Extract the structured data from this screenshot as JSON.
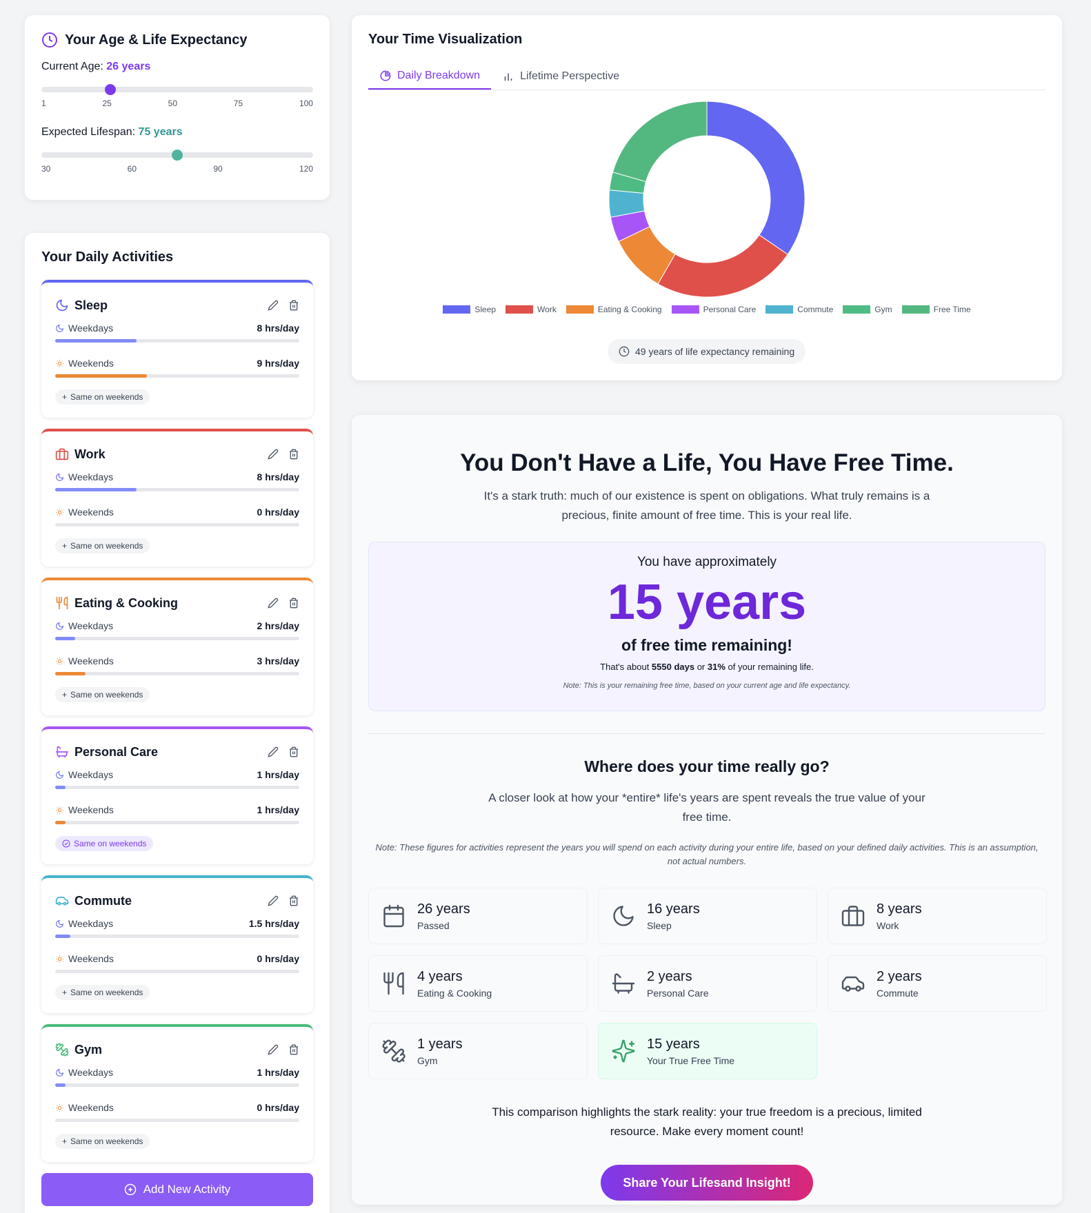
{
  "age": {
    "title": "Your Age & Life Expectancy",
    "current_label": "Current Age:",
    "current_value": "26 years",
    "current_fraction": 0.253,
    "age_ticks": [
      "1",
      "25",
      "50",
      "75",
      "100"
    ],
    "life_label": "Expected Lifespan:",
    "life_value": "75 years",
    "life_fraction": 0.5,
    "life_ticks": [
      "30",
      "60",
      "90",
      "120"
    ]
  },
  "activities": {
    "title": "Your Daily Activities",
    "weekdays_label": "Weekdays",
    "weekends_label": "Weekends",
    "same_label": "Same on weekends",
    "add_label": "Add New Activity",
    "items": [
      {
        "name": "Sleep",
        "icon": "moon-icon",
        "color": "#6366f1",
        "weekdays": "8 hrs/day",
        "weekends": "9 hrs/day",
        "wd_fraction": 0.333,
        "we_fraction": 0.375,
        "same": false
      },
      {
        "name": "Work",
        "icon": "briefcase-icon",
        "color": "#e0504a",
        "weekdays": "8 hrs/day",
        "weekends": "0 hrs/day",
        "wd_fraction": 0.333,
        "we_fraction": 0,
        "same": false
      },
      {
        "name": "Eating & Cooking",
        "icon": "utensils-icon",
        "color": "#ed8936",
        "weekdays": "2 hrs/day",
        "weekends": "3 hrs/day",
        "wd_fraction": 0.083,
        "we_fraction": 0.125,
        "same": false
      },
      {
        "name": "Personal Care",
        "icon": "bath-icon",
        "color": "#a855f7",
        "weekdays": "1 hrs/day",
        "weekends": "1 hrs/day",
        "wd_fraction": 0.042,
        "we_fraction": 0.042,
        "same": true
      },
      {
        "name": "Commute",
        "icon": "car-icon",
        "color": "#45b3d0",
        "weekdays": "1.5 hrs/day",
        "weekends": "0 hrs/day",
        "wd_fraction": 0.0625,
        "we_fraction": 0,
        "same": false
      },
      {
        "name": "Gym",
        "icon": "dumbbell-icon",
        "color": "#48bb78",
        "weekdays": "1 hrs/day",
        "weekends": "0 hrs/day",
        "wd_fraction": 0.042,
        "we_fraction": 0,
        "same": false
      }
    ]
  },
  "viz": {
    "title": "Your Time Visualization",
    "tabs": [
      {
        "label": "Daily Breakdown",
        "active": true
      },
      {
        "label": "Lifetime Perspective",
        "active": false
      }
    ],
    "remaining_label": "49 years of life expectancy remaining"
  },
  "chart_data": {
    "type": "pie",
    "donut": true,
    "categories": [
      "Sleep",
      "Work",
      "Eating & Cooking",
      "Personal Care",
      "Commute",
      "Gym",
      "Free Time"
    ],
    "values": [
      8.29,
      5.71,
      2.29,
      1.0,
      1.07,
      0.71,
      4.93
    ],
    "colors": [
      "#6366f1",
      "#e0504a",
      "#ed8936",
      "#a855f7",
      "#4fb3d0",
      "#4fbb84",
      "#53b880"
    ],
    "legend_position": "bottom"
  },
  "insight": {
    "title": "You Don't Have a Life, You Have Free Time.",
    "intro": "It's a stark truth: much of our existence is spent on obligations. What truly remains is a precious, finite amount of free time. This is your real life.",
    "approx": "You have approximately",
    "years": "15 years",
    "remaining": "of free time remaining!",
    "days_prefix": "That's about ",
    "days": "5550 days",
    "days_mid": " or ",
    "percent": "31%",
    "days_suffix": " of your remaining life.",
    "note": "Note: This is your remaining free time, based on your current age and life expectancy.",
    "where_title": "Where does your time really go?",
    "where_intro": "A closer look at how your *entire* life's years are spent reveals the true value of your free time.",
    "where_note": "Note: These figures for activities represent the years you will spend on each activity during your entire life, based on your defined daily activities. This is an assumption, not actual numbers.",
    "stats": [
      {
        "value": "26 years",
        "label": "Passed",
        "icon": "calendar-icon"
      },
      {
        "value": "16 years",
        "label": "Sleep",
        "icon": "moon-icon"
      },
      {
        "value": "8 years",
        "label": "Work",
        "icon": "briefcase-icon"
      },
      {
        "value": "4 years",
        "label": "Eating & Cooking",
        "icon": "utensils-icon"
      },
      {
        "value": "2 years",
        "label": "Personal Care",
        "icon": "bath-icon"
      },
      {
        "value": "2 years",
        "label": "Commute",
        "icon": "car-icon"
      },
      {
        "value": "1 years",
        "label": "Gym",
        "icon": "dumbbell-icon"
      },
      {
        "value": "15 years",
        "label": "Your True Free Time",
        "icon": "sparkles-icon"
      }
    ],
    "closing": "This comparison highlights the stark reality: your true freedom is a precious, limited resource. Make every moment count!",
    "share_label": "Share Your Lifesand Insight!"
  }
}
